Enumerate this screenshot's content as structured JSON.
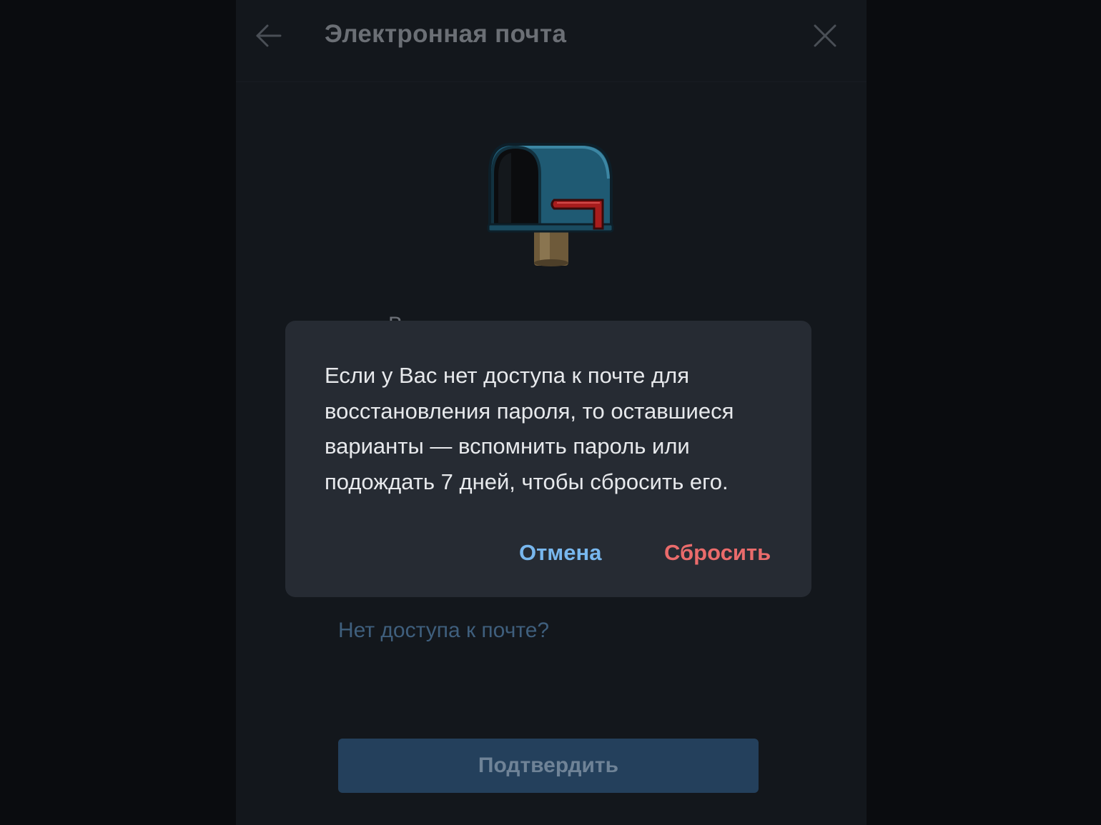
{
  "colors": {
    "page_background": "#0a0c0f",
    "panel_background": "#13171c",
    "dialog_background": "#262b33",
    "accent_blue": "#78b7ee",
    "danger_red": "#ea6b6b",
    "button_background": "#24405c",
    "link_muted": "#3f5f7d"
  },
  "header": {
    "title": "Электронная почта",
    "back_icon": "arrow-left-icon",
    "close_icon": "close-icon"
  },
  "illustration": {
    "name": "mailbox-icon"
  },
  "main": {
    "no_access_link": "Нет доступа к почте?",
    "confirm_button": "Подтвердить"
  },
  "dialog": {
    "message": "Если у Вас нет доступа к почте для восстановления пароля, то оставшиеся варианты — вспомнить пароль или подождать 7 дней, чтобы сбросить его.",
    "cancel_label": "Отмена",
    "reset_label": "Сбросить"
  }
}
